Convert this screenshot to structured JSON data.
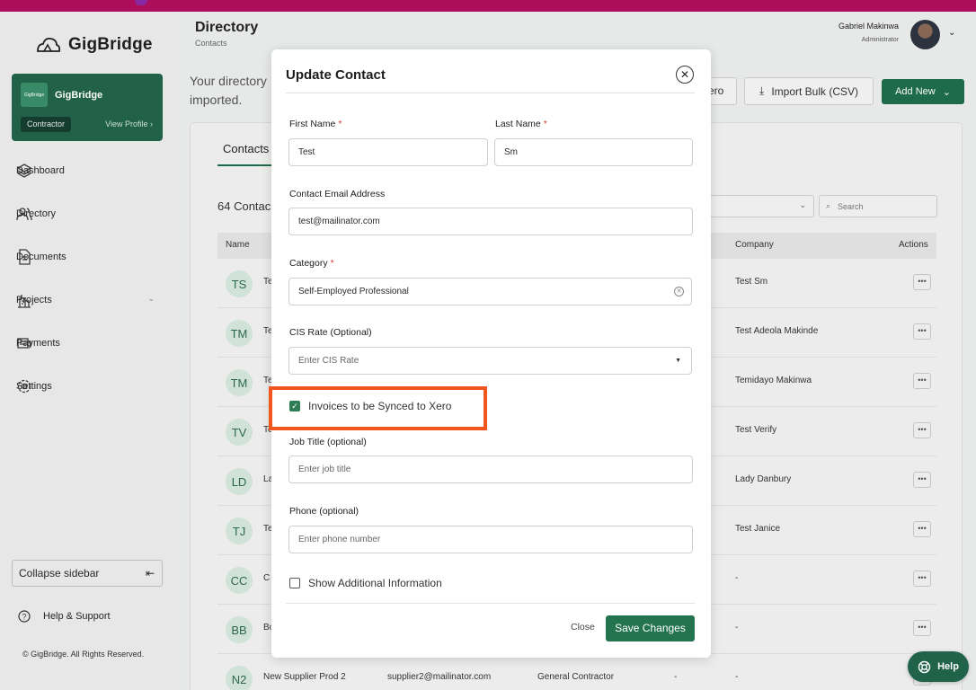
{
  "brand": {
    "name": "GigBridge",
    "mini_logo": "GigBridge"
  },
  "profile_card": {
    "org": "GigBridge",
    "role": "Contractor",
    "view_profile": "View Profile"
  },
  "sidebar": {
    "items": [
      {
        "label": "Dashboard",
        "icon": "layers-icon"
      },
      {
        "label": "Directory",
        "icon": "users-icon"
      },
      {
        "label": "Documents",
        "icon": "document-icon"
      },
      {
        "label": "Projects",
        "icon": "building-icon"
      },
      {
        "label": "Payments",
        "icon": "payments-icon"
      },
      {
        "label": "Settings",
        "icon": "gear-icon"
      }
    ],
    "collapse_label": "Collapse sidebar",
    "help_label": "Help & Support",
    "copyright": "© GigBridge. All Rights Reserved."
  },
  "header": {
    "title": "Directory",
    "crumb": "Contacts",
    "user_name": "Gabriel Makinwa",
    "user_role": "Administrator"
  },
  "page": {
    "intro": "Your directory imported.",
    "xero_button": "ero",
    "import_button": "Import Bulk (CSV)",
    "add_new_button": "Add New",
    "tab_contacts": "Contacts",
    "count": "64 Contac",
    "search_placeholder": "Search"
  },
  "table": {
    "headers": {
      "name": "Name",
      "company": "Company",
      "actions": "Actions"
    },
    "rows": [
      {
        "initials": "TS",
        "name": "Te",
        "email": "",
        "type": "",
        "cis": "",
        "company": "Test Sm"
      },
      {
        "initials": "TM",
        "name": "Te",
        "email": "",
        "type": "",
        "cis": "",
        "company": "Test Adeola Makinde"
      },
      {
        "initials": "TM",
        "name": "Te",
        "email": "",
        "type": "",
        "cis": "",
        "company": "Temidayo Makinwa"
      },
      {
        "initials": "TV",
        "name": "Te",
        "email": "",
        "type": "",
        "cis": "",
        "company": "Test Verify"
      },
      {
        "initials": "LD",
        "name": "La",
        "email": "",
        "type": "",
        "cis": "",
        "company": "Lady Danbury"
      },
      {
        "initials": "TJ",
        "name": "Te",
        "email": "",
        "type": "",
        "cis": "",
        "company": "Test Janice"
      },
      {
        "initials": "CC",
        "name": "C",
        "email": "",
        "type": "",
        "cis": "by",
        "company": "-"
      },
      {
        "initials": "BB",
        "name": "Bo",
        "email": "",
        "type": "",
        "cis": "an",
        "company": "-"
      },
      {
        "initials": "N2",
        "name": "New Supplier Prod 2",
        "email": "supplier2@mailinator.com",
        "type": "General Contractor",
        "cis": "-",
        "company": "-"
      }
    ]
  },
  "modal": {
    "title": "Update Contact",
    "first_name": {
      "label": "First Name",
      "value": "Test"
    },
    "last_name": {
      "label": "Last Name",
      "value": "Sm"
    },
    "email": {
      "label": "Contact Email Address",
      "value": "test@mailinator.com"
    },
    "category": {
      "label": "Category",
      "value": "Self-Employed Professional"
    },
    "cis_rate": {
      "label": "CIS Rate (Optional)",
      "placeholder": "Enter CIS Rate"
    },
    "xero_sync": {
      "label": "Invoices to be Synced to Xero",
      "checked": true
    },
    "job_title": {
      "label": "Job Title (optional)",
      "placeholder": "Enter job title"
    },
    "phone": {
      "label": "Phone (optional)",
      "placeholder": "Enter phone number"
    },
    "additional": {
      "label": "Show Additional Information",
      "checked": false
    },
    "close_label": "Close",
    "save_label": "Save Changes",
    "required_mark": "*"
  },
  "help_fab": "Help",
  "colors": {
    "primary": "#23734e",
    "highlight": "#f0561d",
    "top_strip": "#b10f5d"
  }
}
